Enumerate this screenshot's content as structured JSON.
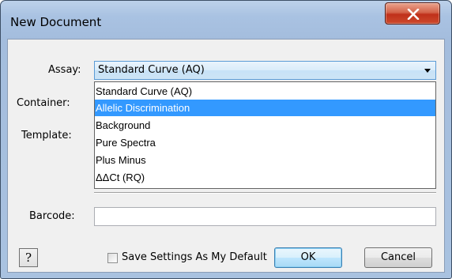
{
  "window": {
    "title": "New Document"
  },
  "form": {
    "assay_label": "Assay:",
    "container_label": "Container:",
    "template_label": "Template:",
    "barcode_label": "Barcode:",
    "assay_value": "Standard Curve (AQ)",
    "barcode_value": "",
    "assay_options": [
      "Standard Curve (AQ)",
      "Allelic Discrimination",
      "Background",
      "Pure Spectra",
      "Plus Minus",
      "ΔΔCt (RQ)"
    ],
    "highlighted_option": "Allelic Discrimination"
  },
  "footer": {
    "help_label": "?",
    "checkbox_label": "Save Settings As My Default",
    "checkbox_checked": false,
    "ok_label": "OK",
    "cancel_label": "Cancel"
  },
  "colors": {
    "selection_highlight": "#3399ff",
    "close_button": "#c7442a"
  },
  "icons": {
    "close": "close-icon",
    "dropdown": "chevron-down-icon",
    "help": "help-icon"
  }
}
